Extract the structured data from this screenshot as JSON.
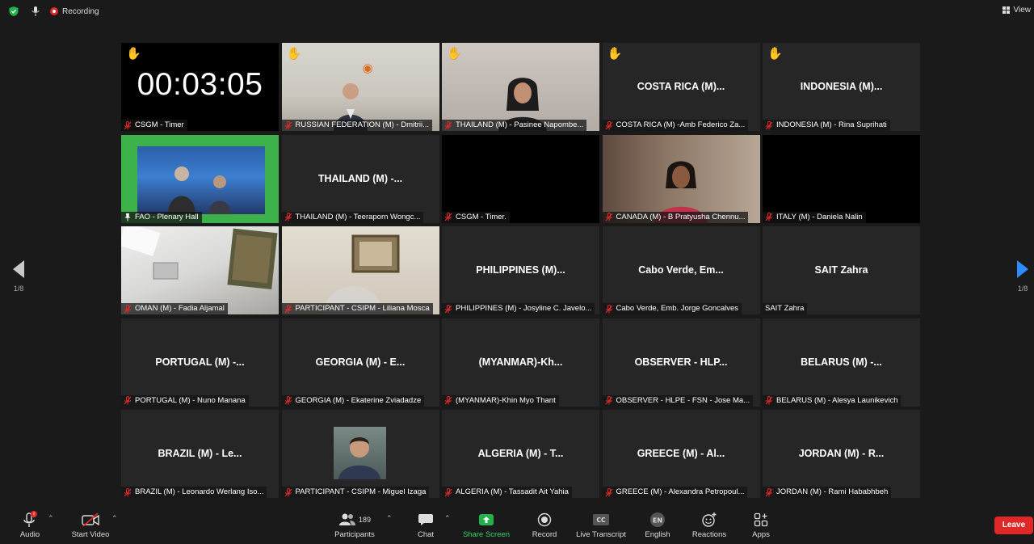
{
  "topbar": {
    "recording_label": "Recording",
    "view_label": "View"
  },
  "nav": {
    "page_indicator": "1/8"
  },
  "timer": "00:03:05",
  "tiles": [
    {
      "label": "CSGM - Timer",
      "center": "",
      "hand": true,
      "kind": "timer"
    },
    {
      "label": "RUSSIAN FEDERATION (M) - Dmitrii...",
      "center": "",
      "hand": true,
      "kind": "video-office"
    },
    {
      "label": "THAILAND (M) - Pasinee Napombe...",
      "center": "",
      "hand": true,
      "kind": "video-thai"
    },
    {
      "label": "COSTA RICA (M) -Amb Federico Za...",
      "center": "COSTA RICA (M)...",
      "hand": true,
      "kind": "name"
    },
    {
      "label": "INDONESIA (M) - Rina Suprihati",
      "center": "INDONESIA  (M)...",
      "hand": true,
      "kind": "name"
    },
    {
      "label": "FAO - Plenary Hall",
      "center": "",
      "hand": false,
      "kind": "video-fao"
    },
    {
      "label": "THAILAND (M) - Teeraporn Wongc...",
      "center": "THAILAND  (M)  -...",
      "hand": false,
      "kind": "name"
    },
    {
      "label": "CSGM - Timer.",
      "center": "",
      "hand": false,
      "kind": "black"
    },
    {
      "label": "CANADA (M) - B Pratyusha Chennu...",
      "center": "",
      "hand": false,
      "kind": "video-canada"
    },
    {
      "label": "ITALY (M) - Daniela Nalin",
      "center": "",
      "hand": false,
      "kind": "black"
    },
    {
      "label": "OMAN (M) - Fadia Aljamal",
      "center": "",
      "hand": false,
      "kind": "video-oman"
    },
    {
      "label": "PARTICIPANT - CSIPM - Liliana Mosca",
      "center": "",
      "hand": false,
      "kind": "video-csipm"
    },
    {
      "label": "PHILIPPINES (M) - Josyline C. Javelo...",
      "center": "PHILIPPINES  (M)...",
      "hand": false,
      "kind": "name"
    },
    {
      "label": "Cabo Verde, Emb. Jorge Goncalves",
      "center": "Cabo Verde, Em...",
      "hand": false,
      "kind": "name"
    },
    {
      "label": "SAIT Zahra",
      "center": "SAIT Zahra",
      "hand": false,
      "kind": "name-nomute"
    },
    {
      "label": "PORTUGAL (M) - Nuno Manana",
      "center": "PORTUGAL  (M)  -...",
      "hand": false,
      "kind": "name"
    },
    {
      "label": "GEORGIA (M) - Ekaterine Zviadadze",
      "center": "GEORGIA  (M)  - E...",
      "hand": false,
      "kind": "name"
    },
    {
      "label": "(MYANMAR)-Khin Myo Thant",
      "center": "(MYANMAR)-Kh...",
      "hand": false,
      "kind": "name"
    },
    {
      "label": "OBSERVER - HLPE - FSN - Jose Ma...",
      "center": "OBSERVER  - HLP...",
      "hand": false,
      "kind": "name"
    },
    {
      "label": "BELARUS (M) - Alesya Launikevich",
      "center": "BELARUS  (M)  -...",
      "hand": false,
      "kind": "name"
    },
    {
      "label": "BRAZIL (M) - Leonardo Werlang Iso...",
      "center": "BRAZIL  (M)  - Le...",
      "hand": false,
      "kind": "name"
    },
    {
      "label": "PARTICIPANT - CSIPM - Miguel Izaga",
      "center": "",
      "hand": false,
      "kind": "avatar"
    },
    {
      "label": "ALGERIA (M) - Tassadit Ait Yahia",
      "center": "ALGERIA  (M)  - T...",
      "hand": false,
      "kind": "name"
    },
    {
      "label": "GREECE (M) - Alexandra Petropoul...",
      "center": "GREECE  (M)  - Al...",
      "hand": false,
      "kind": "name"
    },
    {
      "label": "JORDAN (M) - Rami Hababhbeh",
      "center": "JORDAN  (M)  - R...",
      "hand": false,
      "kind": "name"
    }
  ],
  "toolbar": {
    "audio": "Audio",
    "audio_badge": "!",
    "start_video": "Start Video",
    "participants": "Participants",
    "participants_count": "189",
    "chat": "Chat",
    "share_screen": "Share Screen",
    "record": "Record",
    "live_transcript": "Live Transcript",
    "cc_glyph": "CC",
    "english": "English",
    "english_glyph": "EN",
    "reactions": "Reactions",
    "apps": "Apps",
    "leave": "Leave"
  },
  "colors": {
    "accent_blue": "#2d8cff",
    "leave_red": "#e02828",
    "share_green": "#33d068",
    "active_speaker": "#e8f07a"
  }
}
